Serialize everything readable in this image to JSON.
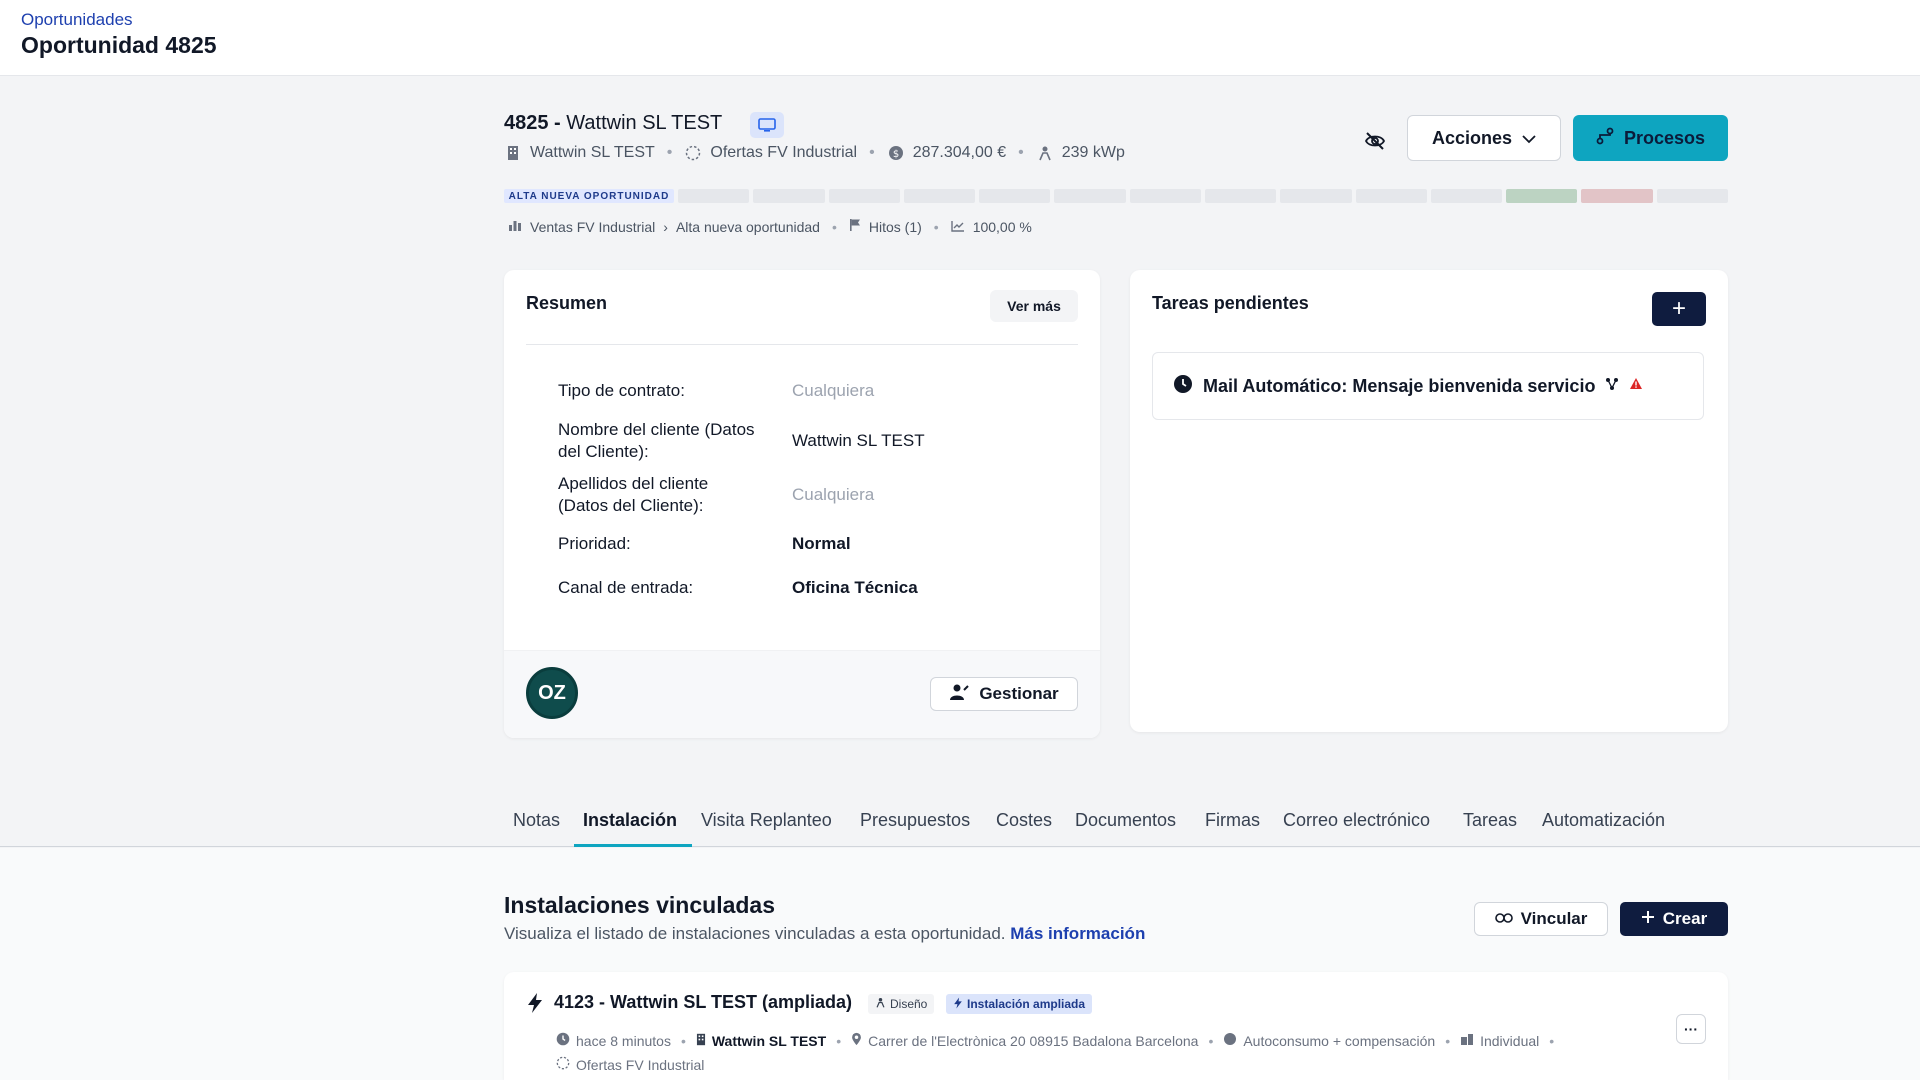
{
  "topbar": {
    "breadcrumb": "Oportunidades",
    "title": "Oportunidad 4825"
  },
  "opportunity": {
    "id": "4825 -",
    "name": "Wattwin SL TEST",
    "meta": {
      "company": "Wattwin SL TEST",
      "offer": "Ofertas FV Industrial",
      "amount": "287.304,00 €",
      "power": "239 kWp"
    },
    "stage_label": "ALTA NUEVA OPORTUNIDAD",
    "pipeline": {
      "pipeline_name": "Ventas FV Industrial",
      "stage": "Alta nueva oportunidad",
      "milestones": "Hitos (1)",
      "probability": "100,00 %"
    }
  },
  "actions": {
    "acciones_label": "Acciones",
    "procesos_label": "Procesos"
  },
  "summary": {
    "title": "Resumen",
    "ver_mas": "Ver más",
    "fields": [
      {
        "label": "Tipo de contrato:",
        "value": "Cualquiera"
      },
      {
        "label": "Nombre del cliente (Datos del Cliente):",
        "value": "Wattwin SL TEST"
      },
      {
        "label": "Apellidos del cliente (Datos del Cliente):",
        "value": "Cualquiera"
      },
      {
        "label": "Prioridad:",
        "value": "Normal"
      },
      {
        "label": "Canal de entrada:",
        "value": "Oficina Técnica"
      }
    ],
    "avatar_initials": "OZ",
    "gestionar_label": "Gestionar"
  },
  "tasks": {
    "title": "Tareas pendientes",
    "add_label": "+",
    "items": [
      {
        "text": "Mail Automático: Mensaje bienvenida servicio"
      }
    ]
  },
  "tabs": [
    {
      "label": "Notas"
    },
    {
      "label": "Instalación"
    },
    {
      "label": "Visita Replanteo"
    },
    {
      "label": "Presupuestos"
    },
    {
      "label": "Costes"
    },
    {
      "label": "Documentos"
    },
    {
      "label": "Firmas"
    },
    {
      "label": "Correo electrónico"
    },
    {
      "label": "Tareas"
    },
    {
      "label": "Automatización"
    }
  ],
  "installations": {
    "title": "Instalaciones vinculadas",
    "subtitle": "Visualiza el listado de instalaciones vinculadas a esta oportunidad.",
    "more_info": "Más información",
    "vincular_label": "Vincular",
    "crear_label": "Crear",
    "items": [
      {
        "name": "4123 - Wattwin SL TEST (ampliada)",
        "tag_design": "Diseño",
        "tag_type": "Instalación ampliada",
        "time": "hace 8 minutos",
        "company": "Wattwin SL TEST",
        "address": "Carrer de l'Electrònica 20 08915 Badalona Barcelona",
        "mode": "Autoconsumo + compensación",
        "kind": "Individual",
        "offer": "Ofertas FV Industrial"
      }
    ]
  },
  "colors": {
    "accent": "#0ea5c0",
    "navy": "#0f1c3f",
    "link": "#1e40af"
  }
}
